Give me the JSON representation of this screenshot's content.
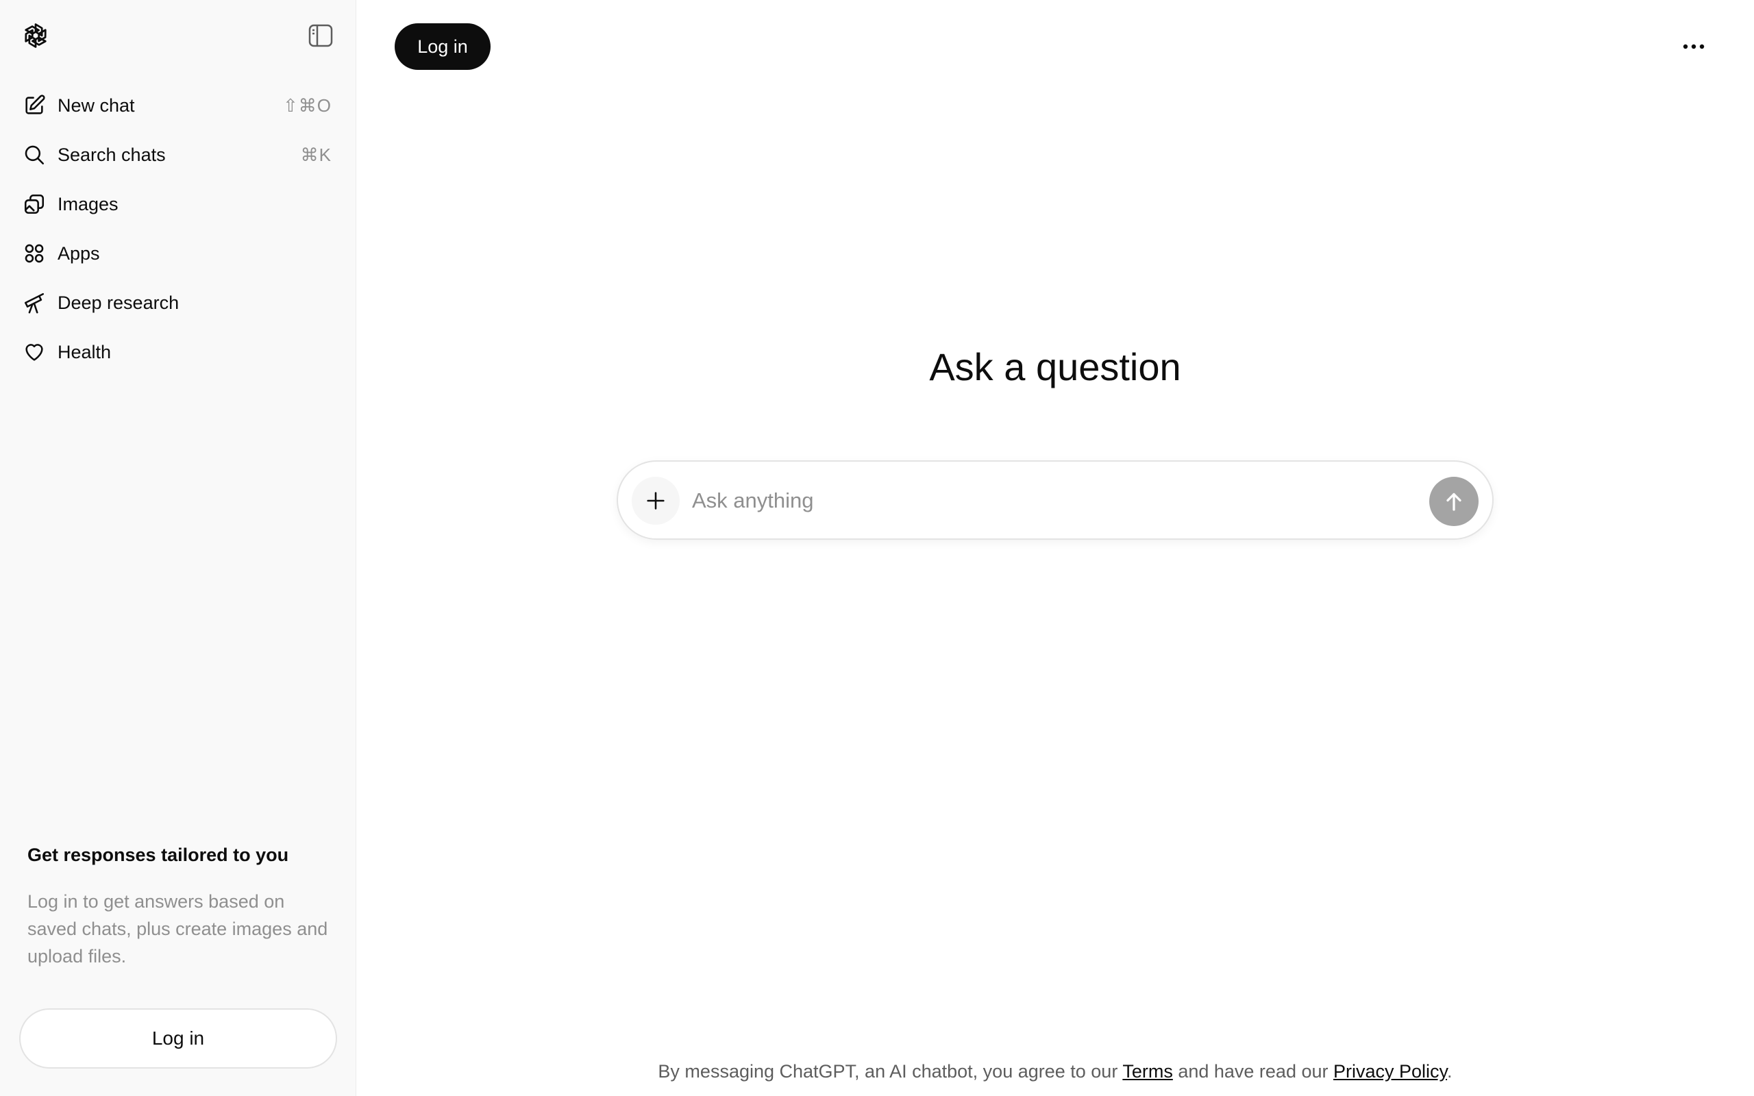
{
  "sidebar": {
    "logo_icon": "openai-logo-icon",
    "toggle_icon": "sidebar-toggle-icon",
    "items": [
      {
        "label": "New chat",
        "shortcut": "⇧⌘O",
        "icon": "edit-icon"
      },
      {
        "label": "Search chats",
        "shortcut": "⌘K",
        "icon": "search-icon"
      },
      {
        "label": "Images",
        "shortcut": "",
        "icon": "images-icon"
      },
      {
        "label": "Apps",
        "shortcut": "",
        "icon": "apps-grid-icon"
      },
      {
        "label": "Deep research",
        "shortcut": "",
        "icon": "telescope-icon"
      },
      {
        "label": "Health",
        "shortcut": "",
        "icon": "heart-icon"
      }
    ],
    "promo": {
      "title": "Get responses tailored to you",
      "text": "Log in to get answers based on saved chats, plus create images and upload files."
    },
    "login_label": "Log in"
  },
  "header": {
    "login_label": "Log in",
    "more_icon": "more-horizontal-icon"
  },
  "main": {
    "headline": "Ask a question",
    "composer": {
      "placeholder": "Ask anything",
      "value": "",
      "plus_icon": "plus-icon",
      "send_icon": "arrow-up-icon"
    }
  },
  "footer": {
    "prefix": "By messaging ChatGPT, an AI chatbot, you agree to our ",
    "terms": "Terms",
    "middle": " and have read our ",
    "privacy": "Privacy Policy",
    "suffix": "."
  },
  "colors": {
    "sidebar_bg": "#f9f9f9",
    "primary": "#0d0d0d",
    "muted_text": "#8f8f8f",
    "send_button_disabled": "#a4a4a4"
  }
}
